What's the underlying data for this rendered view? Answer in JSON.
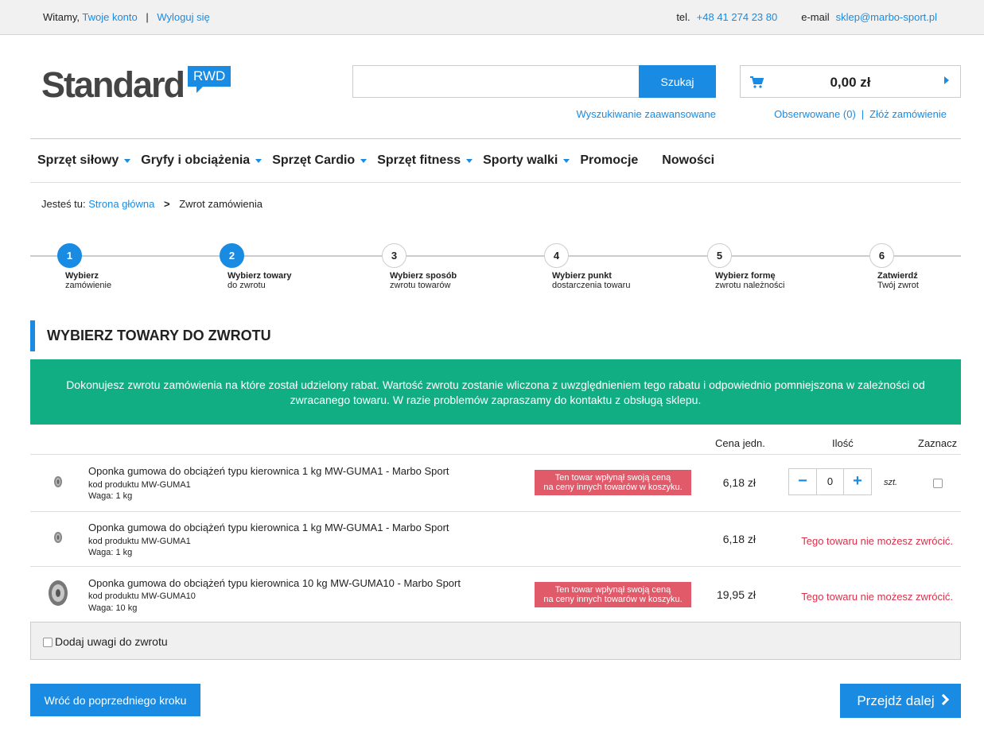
{
  "topbar": {
    "greeting": "Witamy,",
    "account_link": "Twoje konto",
    "separator": "|",
    "logout_link": "Wyloguj się",
    "phone_label": "tel.",
    "phone": "+48 41 274 23 80",
    "email_label": "e-mail",
    "email": "sklep@marbo-sport.pl"
  },
  "logo": {
    "word": "Standard",
    "badge": "RWD"
  },
  "search": {
    "value": "",
    "button_label": "Szukaj",
    "advanced_link": "Wyszukiwanie zaawansowane"
  },
  "cart": {
    "total": "0,00 zł",
    "observed_link": "Obserwowane (0)",
    "order_link": "Złóż zamówienie"
  },
  "nav": {
    "items": [
      "Sprzęt siłowy",
      "Gryfy i obciążenia",
      "Sprzęt Cardio",
      "Sprzęt fitness",
      "Sporty walki",
      "Promocje",
      "Nowości"
    ]
  },
  "breadcrumb": {
    "label": "Jesteś tu:",
    "home": "Strona główna",
    "sep": ">",
    "current": "Zwrot zamówienia"
  },
  "steps": [
    {
      "num": "1",
      "title": "Wybierz",
      "sub": "zamówienie",
      "active": true
    },
    {
      "num": "2",
      "title": "Wybierz towary",
      "sub": "do zwrotu",
      "active": true
    },
    {
      "num": "3",
      "title": "Wybierz sposób",
      "sub": "zwrotu towarów",
      "active": false
    },
    {
      "num": "4",
      "title": "Wybierz punkt",
      "sub": "dostarczenia towaru",
      "active": false
    },
    {
      "num": "5",
      "title": "Wybierz formę",
      "sub": "zwrotu należności",
      "active": false
    },
    {
      "num": "6",
      "title": "Zatwierdź",
      "sub": "Twój zwrot",
      "active": false
    }
  ],
  "section_title": "WYBIERZ TOWARY DO ZWROTU",
  "notice": "Dokonujesz zwrotu zamówienia na które został udzielony rabat. Wartość zwrotu zostanie wliczona z uwzględnieniem tego rabatu i odpowiednio pomniejszona w zależności od zwracanego towaru. W razie problemów zapraszamy do kontaktu z obsługą sklepu.",
  "table": {
    "headers": {
      "price": "Cena jedn.",
      "qty": "Ilość",
      "select": "Zaznacz"
    },
    "rows": [
      {
        "name": "Oponka gumowa do obciążeń typu kierownica 1 kg MW-GUMA1 - Marbo Sport",
        "code": "kod produktu MW-GUMA1",
        "weight": "Waga: 1 kg",
        "promo_line1": "Ten towar wpłynął swoją ceną",
        "promo_line2": "na ceny innych towarów w koszyku.",
        "price": "6,18 zł",
        "qty_minus": "−",
        "qty_value": "0",
        "qty_plus": "+",
        "unit": "szt."
      },
      {
        "name": "Oponka gumowa do obciążeń typu kierownica 1 kg MW-GUMA1 - Marbo Sport",
        "code": "kod produktu MW-GUMA1",
        "weight": "Waga: 1 kg",
        "price": "6,18 zł",
        "cannot": "Tego towaru nie możesz zwrócić."
      },
      {
        "name": "Oponka gumowa do obciążeń typu kierownica 10 kg MW-GUMA10 - Marbo Sport",
        "code": "kod produktu MW-GUMA10",
        "weight": "Waga: 10 kg",
        "promo_line1": "Ten towar wpłynął swoją ceną",
        "promo_line2": "na ceny innych towarów w koszyku.",
        "price": "19,95 zł",
        "cannot": "Tego towaru nie możesz zwrócić."
      }
    ]
  },
  "notes_label": "Dodaj uwagi do zwrotu",
  "buttons": {
    "back": "Wróć do poprzedniego kroku",
    "next": "Przejdź dalej"
  },
  "colors": {
    "accent": "#1a8be3",
    "notice_bg": "#11ad83",
    "promo_bg": "#e05a6a",
    "error_text": "#d9304a"
  }
}
